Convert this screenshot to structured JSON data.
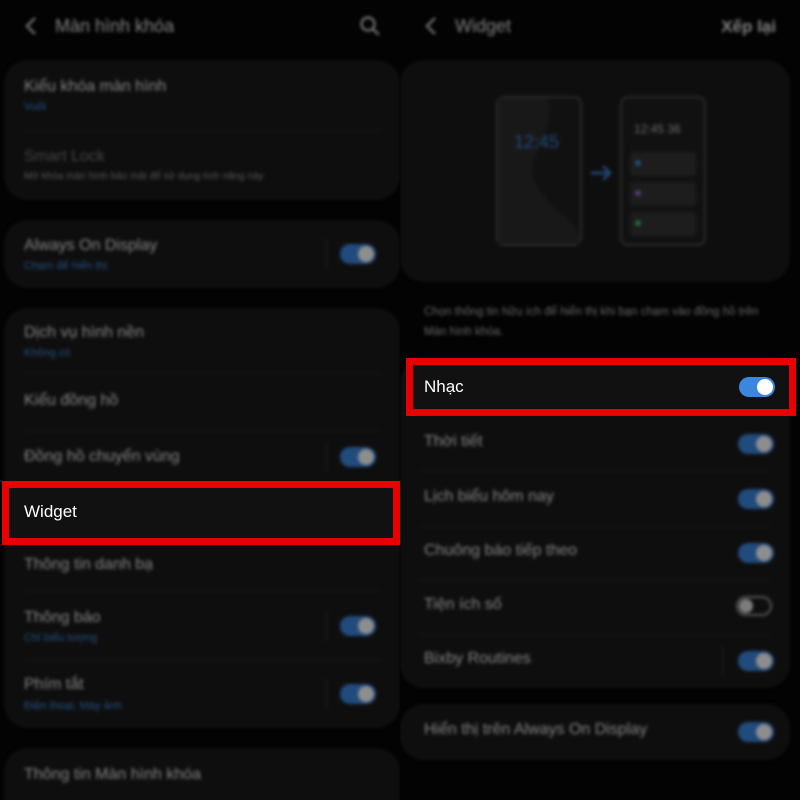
{
  "left": {
    "header": {
      "title": "Màn hình khóa"
    },
    "card1": [
      {
        "title": "Kiểu khóa màn hình",
        "subtitle": "Vuốt"
      },
      {
        "title": "Smart Lock",
        "subtitle": "Mở khóa màn hình bảo mật để sử dụng tính năng này"
      }
    ],
    "aod": {
      "title": "Always On Display",
      "subtitle": "Chạm để hiển thị",
      "enabled": true
    },
    "card3": [
      {
        "title": "Dịch vụ hình nền",
        "subtitle": "Không có"
      },
      {
        "title": "Kiểu đồng hồ",
        "subtitle": ""
      },
      {
        "title": "Đồng hồ chuyển vùng",
        "subtitle": "",
        "enabled": true
      },
      {
        "title": "Widget",
        "subtitle": ""
      },
      {
        "title": "Thông tin danh bạ",
        "subtitle": ""
      },
      {
        "title": "Thông báo",
        "subtitle": "Chỉ biểu tượng",
        "enabled": true
      },
      {
        "title": "Phím tắt",
        "subtitle": "Điện thoại, Máy ảnh",
        "enabled": true
      }
    ],
    "card4": {
      "title": "Thông tin Màn hình khóa"
    }
  },
  "right": {
    "header": {
      "title": "Widget",
      "action": "Xếp lại"
    },
    "preview": {
      "clock_before": "12:45",
      "clock_after": "12:45 36"
    },
    "description": "Chọn thông tin hữu ích để hiển thị khi bạn chạm vào đồng hồ trên Màn hình khóa.",
    "items": [
      {
        "title": "Nhạc",
        "enabled": true
      },
      {
        "title": "Thời tiết",
        "enabled": true
      },
      {
        "title": "Lịch biểu hôm nay",
        "enabled": true
      },
      {
        "title": "Chuông báo tiếp theo",
        "enabled": true
      },
      {
        "title": "Tiện ích số",
        "enabled": false
      },
      {
        "title": "Bixby Routines",
        "enabled": true
      }
    ],
    "aod_show": {
      "title": "Hiển thị trên Always On Display",
      "enabled": true
    }
  },
  "colors": {
    "accent": "#3a87e0",
    "highlight": "#e80000",
    "card": "#181818"
  }
}
